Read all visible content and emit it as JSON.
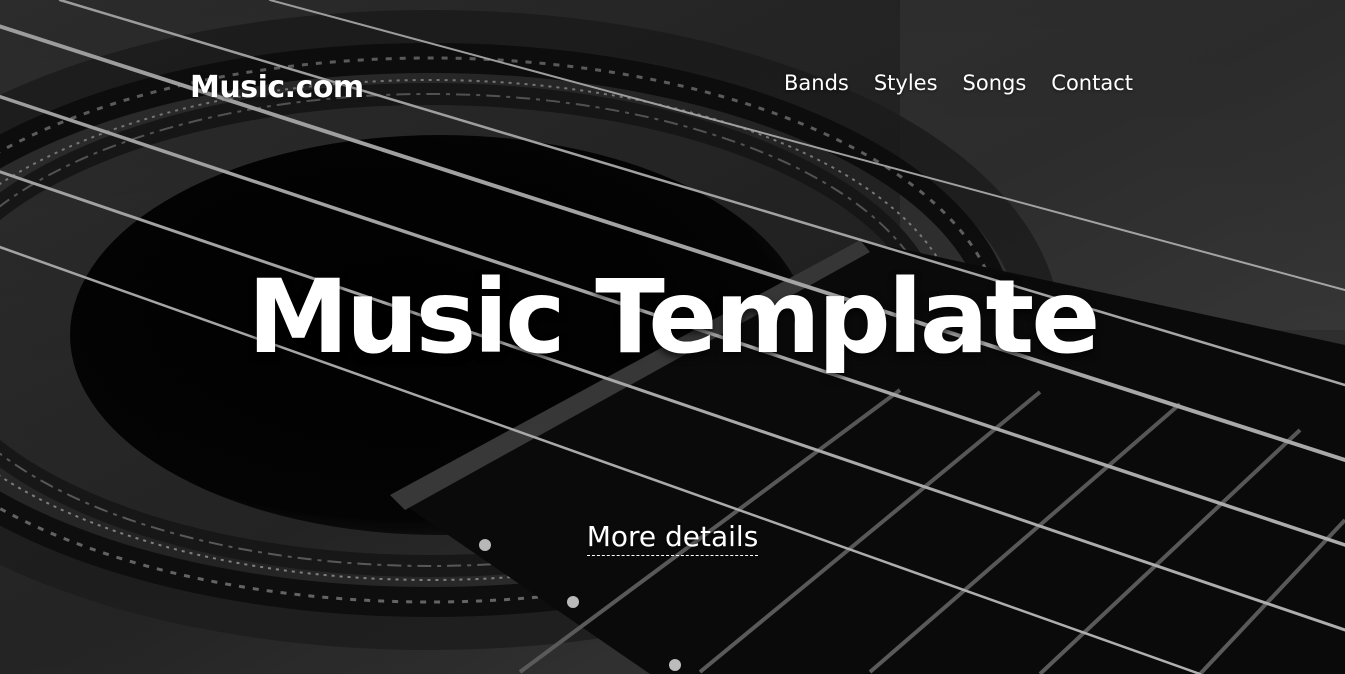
{
  "header": {
    "logo": "Music.com",
    "nav": [
      "Bands",
      "Styles",
      "Songs",
      "Contact"
    ]
  },
  "hero": {
    "title": "Music Template",
    "cta": "More details",
    "background": "guitar-closeup-photo"
  }
}
